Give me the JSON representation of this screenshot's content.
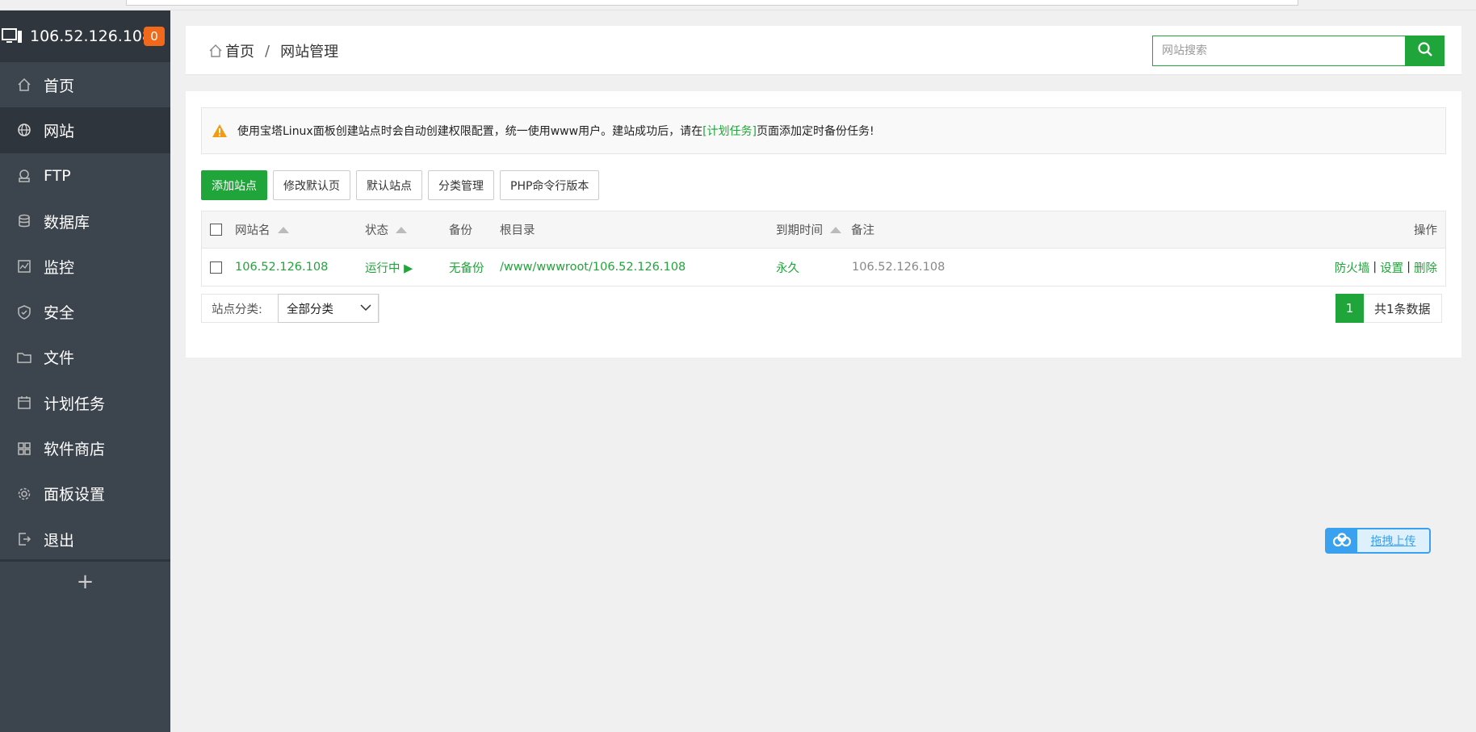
{
  "sidebar": {
    "server_ip": "106.52.126.108",
    "badge_count": "0",
    "items": [
      {
        "label": "首页",
        "icon": "home-icon"
      },
      {
        "label": "网站",
        "icon": "globe-icon"
      },
      {
        "label": "FTP",
        "icon": "ftp-icon"
      },
      {
        "label": "数据库",
        "icon": "database-icon"
      },
      {
        "label": "监控",
        "icon": "monitor-icon"
      },
      {
        "label": "安全",
        "icon": "shield-icon"
      },
      {
        "label": "文件",
        "icon": "folder-icon"
      },
      {
        "label": "计划任务",
        "icon": "calendar-icon"
      },
      {
        "label": "软件商店",
        "icon": "grid-icon"
      },
      {
        "label": "面板设置",
        "icon": "gear-icon"
      },
      {
        "label": "退出",
        "icon": "logout-icon"
      }
    ],
    "active_item": "网站",
    "add_label": "+"
  },
  "breadcrumb": {
    "home": "首页",
    "separator": "/",
    "current": "网站管理"
  },
  "search": {
    "placeholder": "网站搜索"
  },
  "notice": {
    "text_before": "使用宝塔Linux面板创建站点时会自动创建权限配置，统一使用www用户。建站成功后，请在",
    "link": "[计划任务]",
    "text_after": "页面添加定时备份任务!"
  },
  "toolbar": {
    "add_site": "添加站点",
    "edit_default_page": "修改默认页",
    "default_site": "默认站点",
    "category_manage": "分类管理",
    "php_cli_version": "PHP命令行版本"
  },
  "table": {
    "columns": {
      "name": "网站名",
      "status": "状态",
      "backup": "备份",
      "root": "根目录",
      "expire": "到期时间",
      "remark": "备注",
      "actions": "操作"
    },
    "rows": [
      {
        "name": "106.52.126.108",
        "status": "运行中 ▶",
        "backup": "无备份",
        "root": "/www/wwwroot/106.52.126.108",
        "expire": "永久",
        "remark": "106.52.126.108",
        "actions": [
          "防火墙",
          "设置",
          "删除"
        ]
      }
    ]
  },
  "footer": {
    "category_label": "站点分类:",
    "category_value": "全部分类",
    "page_current": "1",
    "page_total": "共1条数据"
  },
  "upload_widget": {
    "label": "拖拽上传"
  },
  "colors": {
    "accent": "#20a53a",
    "sidebar_bg": "#3c444d",
    "sidebar_active": "#2f353c",
    "badge": "#f2691b",
    "upload_blue": "#3aa0f0"
  }
}
